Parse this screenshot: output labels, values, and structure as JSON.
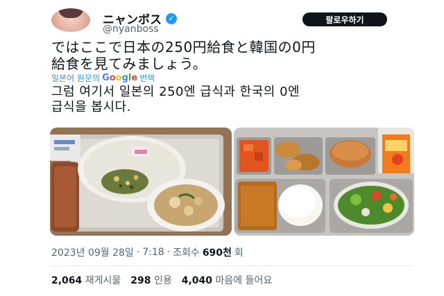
{
  "tweet": {
    "display_name": "ニャンボス",
    "handle": "@nyanboss",
    "follow_label": "팔로우하기",
    "text_line1": "ではここで日本の250円給食と韓国の0円",
    "text_line2": "給食を見てみましょう。",
    "translate_prefix": "일본어 원문의",
    "translate_brand_G": "G",
    "translate_brand_o1": "o",
    "translate_brand_o2": "o",
    "translate_brand_g": "g",
    "translate_brand_l": "l",
    "translate_brand_e": "e",
    "translate_suffix": "번역",
    "translated_line1": "그럼 여기서 일본의 250엔 급식과 한국의 0엔",
    "translated_line2": "급식을 봅시다.",
    "date": "2023년 09월 28일",
    "sep1": "·",
    "time": "7:18",
    "sep2": "·",
    "views_label": "조회수",
    "views_count": "690천",
    "views_unit": "회",
    "retweets_count": "2,064",
    "retweets_label": "재게시물",
    "quotes_count": "298",
    "quotes_label": "인용",
    "likes_count": "4,040",
    "likes_label": "마음에 들어요"
  },
  "colors": {
    "accent": "#1d9bf0",
    "text": "#0f1419",
    "muted": "#536471"
  }
}
